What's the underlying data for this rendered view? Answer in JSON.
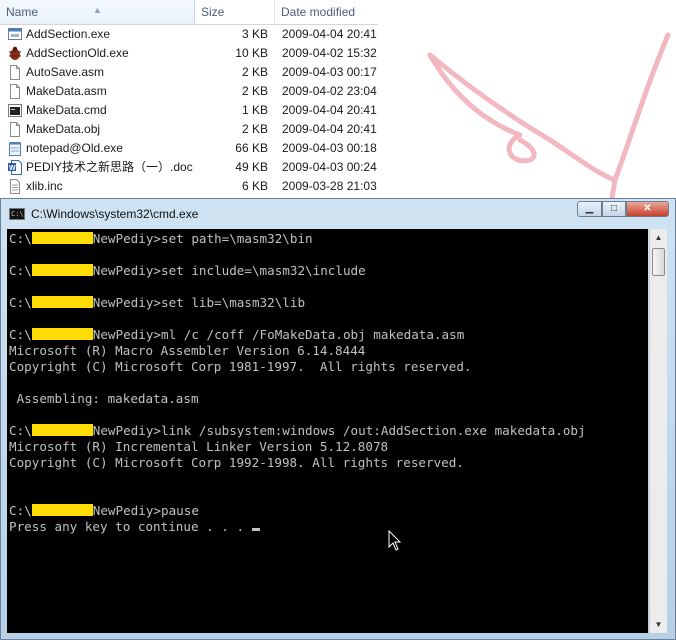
{
  "explorer": {
    "columns": {
      "name": "Name",
      "size": "Size",
      "date": "Date modified"
    },
    "files": [
      {
        "name": "AddSection.exe",
        "size": "3 KB",
        "date": "2009-04-04 20:41",
        "icon": "exe-icon"
      },
      {
        "name": "AddSectionOld.exe",
        "size": "10 KB",
        "date": "2009-04-02 15:32",
        "icon": "bug-exe-icon"
      },
      {
        "name": "AutoSave.asm",
        "size": "2 KB",
        "date": "2009-04-03 00:17",
        "icon": "file-icon"
      },
      {
        "name": "MakeData.asm",
        "size": "2 KB",
        "date": "2009-04-02 23:04",
        "icon": "file-icon"
      },
      {
        "name": "MakeData.cmd",
        "size": "1 KB",
        "date": "2009-04-04 20:41",
        "icon": "cmd-file-icon"
      },
      {
        "name": "MakeData.obj",
        "size": "2 KB",
        "date": "2009-04-04 20:41",
        "icon": "file-icon"
      },
      {
        "name": "notepad@Old.exe",
        "size": "66 KB",
        "date": "2009-04-03 00:18",
        "icon": "notepad-icon"
      },
      {
        "name": "PEDIY技术之新思路（一）.doc",
        "size": "49 KB",
        "date": "2009-04-03 00:24",
        "icon": "word-doc-icon"
      },
      {
        "name": "xlib.inc",
        "size": "6 KB",
        "date": "2009-03-28 21:03",
        "icon": "inc-file-icon"
      }
    ]
  },
  "cmd": {
    "title": "C:\\Windows\\system32\\cmd.exe",
    "icon_text": "C:\\",
    "buttons": {
      "min": "▁",
      "max": "□",
      "close": "✕"
    },
    "lines": {
      "l1_suffix": "NewPediy>set path=\\masm32\\bin",
      "l2_suffix": "NewPediy>set include=\\masm32\\include",
      "l3_suffix": "NewPediy>set lib=\\masm32\\lib",
      "l4_suffix": "NewPediy>ml /c /coff /FoMakeData.obj makedata.asm",
      "l5": "Microsoft (R) Macro Assembler Version 6.14.8444",
      "l6": "Copyright (C) Microsoft Corp 1981-1997.  All rights reserved.",
      "l7": " Assembling: makedata.asm",
      "l8_suffix": "NewPediy>link /subsystem:windows /out:AddSection.exe makedata.obj",
      "l9": "Microsoft (R) Incremental Linker Version 5.12.8078",
      "l10": "Copyright (C) Microsoft Corp 1992-1998. All rights reserved.",
      "l11_suffix": "NewPediy>pause",
      "l12": "Press any key to continue . . . ",
      "prompt_prefix": "C:\\"
    }
  },
  "colors": {
    "redaction": "#ffdd00",
    "console_bg": "#000000",
    "console_fg": "#c0c0c0"
  }
}
